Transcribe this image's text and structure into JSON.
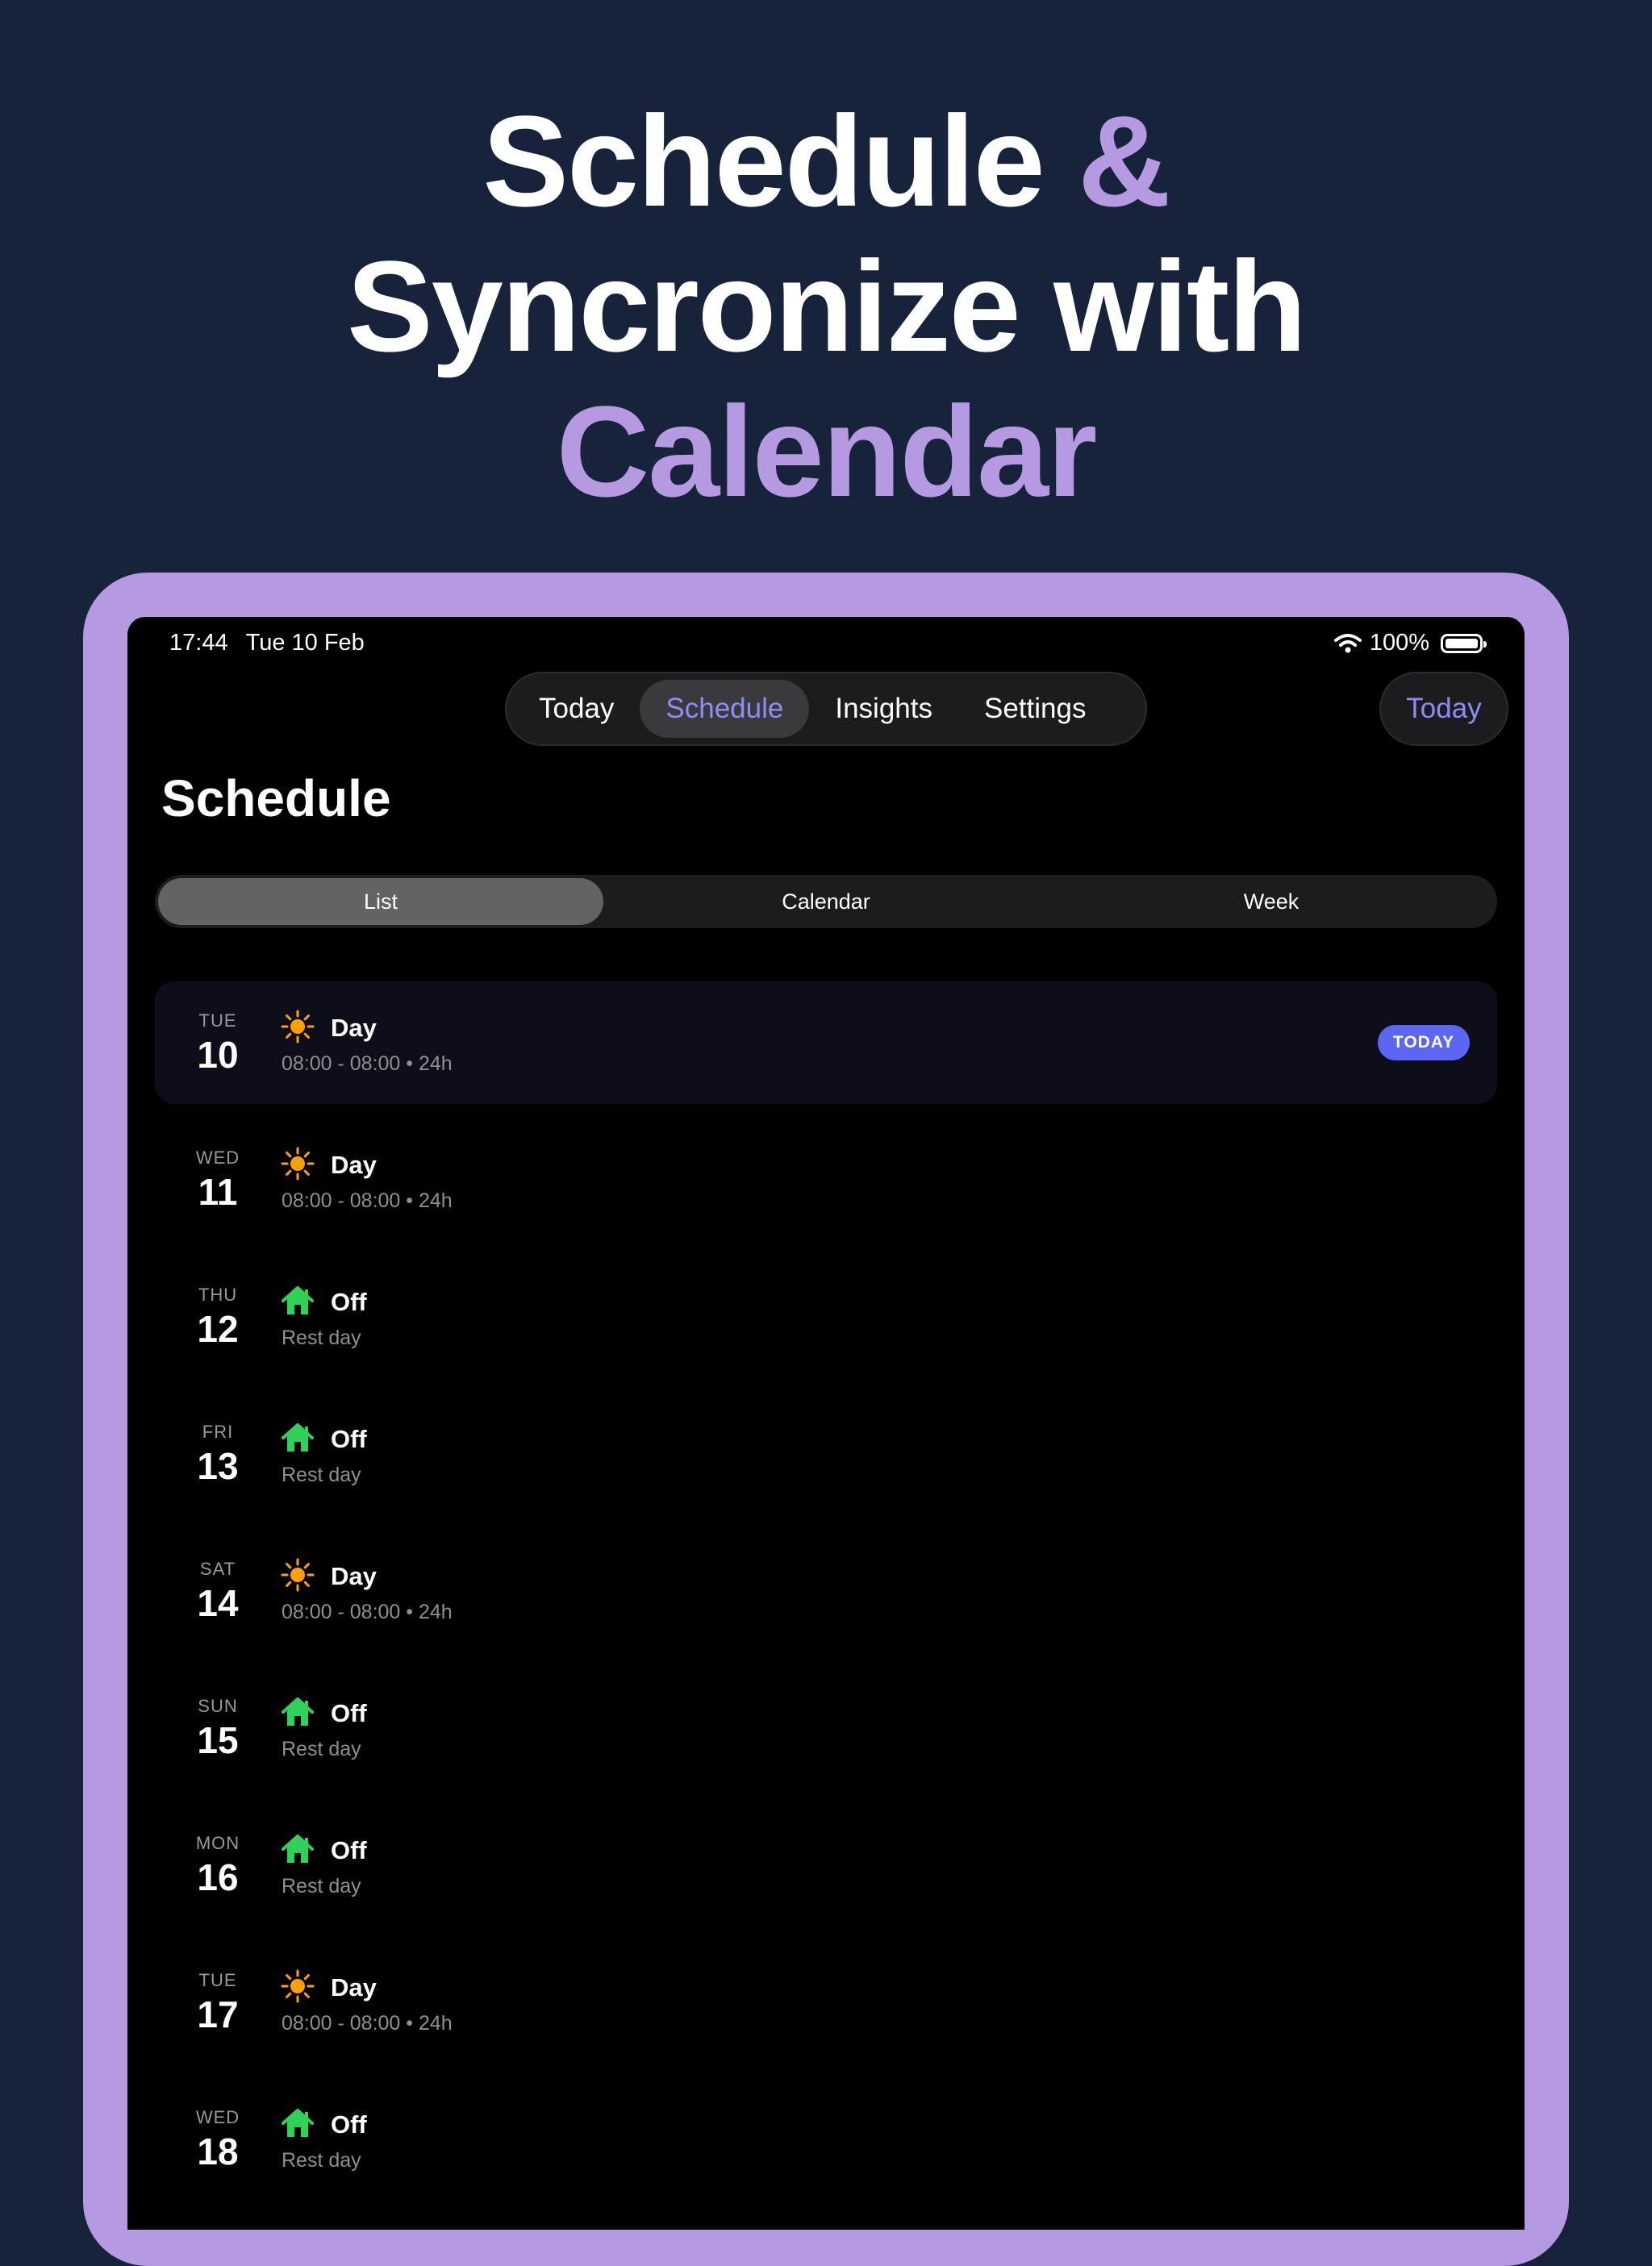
{
  "headline": {
    "line1_white": "Schedule",
    "line1_accent": "&",
    "line2": "Syncronize with",
    "line3_accent": "Calendar"
  },
  "status_bar": {
    "time": "17:44",
    "date": "Tue 10 Feb",
    "battery": "100%"
  },
  "tabs": [
    {
      "label": "Today",
      "active": false
    },
    {
      "label": "Schedule",
      "active": true
    },
    {
      "label": "Insights",
      "active": false
    },
    {
      "label": "Settings",
      "active": false
    }
  ],
  "today_button": "Today",
  "page_title": "Schedule",
  "segments": [
    {
      "label": "List",
      "active": true
    },
    {
      "label": "Calendar",
      "active": false
    },
    {
      "label": "Week",
      "active": false
    }
  ],
  "today_badge": "TODAY",
  "shifts": [
    {
      "dow": "TUE",
      "day": "10",
      "type": "Day",
      "detail": "08:00 - 08:00 • 24h",
      "icon": "sun-icon",
      "today": true
    },
    {
      "dow": "WED",
      "day": "11",
      "type": "Day",
      "detail": "08:00 - 08:00 • 24h",
      "icon": "sun-icon",
      "today": false
    },
    {
      "dow": "THU",
      "day": "12",
      "type": "Off",
      "detail": "Rest day",
      "icon": "house-icon",
      "today": false
    },
    {
      "dow": "FRI",
      "day": "13",
      "type": "Off",
      "detail": "Rest day",
      "icon": "house-icon",
      "today": false
    },
    {
      "dow": "SAT",
      "day": "14",
      "type": "Day",
      "detail": "08:00 - 08:00 • 24h",
      "icon": "sun-icon",
      "today": false
    },
    {
      "dow": "SUN",
      "day": "15",
      "type": "Off",
      "detail": "Rest day",
      "icon": "house-icon",
      "today": false
    },
    {
      "dow": "MON",
      "day": "16",
      "type": "Off",
      "detail": "Rest day",
      "icon": "house-icon",
      "today": false
    },
    {
      "dow": "TUE",
      "day": "17",
      "type": "Day",
      "detail": "08:00 - 08:00 • 24h",
      "icon": "sun-icon",
      "today": false
    },
    {
      "dow": "WED",
      "day": "18",
      "type": "Off",
      "detail": "Rest day",
      "icon": "house-icon",
      "today": false
    }
  ],
  "colors": {
    "background": "#17223b",
    "accent": "#b59ae2",
    "tab_active": "#8f8cf6",
    "badge": "#5c66f2",
    "sun": "#ff9f0a",
    "house": "#30d158"
  }
}
